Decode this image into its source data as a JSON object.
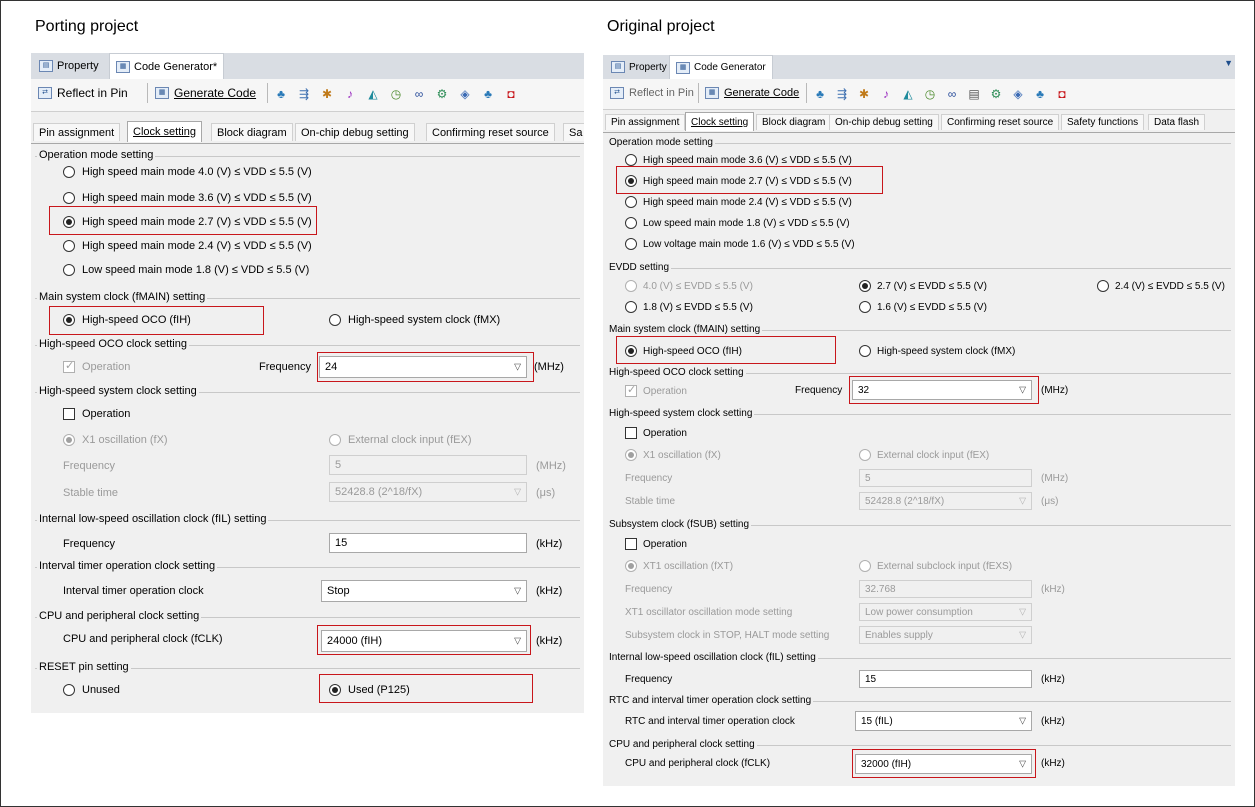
{
  "left": {
    "heading": "Porting project",
    "view_tabs": [
      "Property",
      "Code Generator*"
    ],
    "toolbar": {
      "reflect": "Reflect in Pin",
      "generate": "Generate Code"
    },
    "tabs": [
      "Pin assignment",
      "Clock setting",
      "Block diagram",
      "On-chip debug setting",
      "Confirming reset source",
      "Sa"
    ],
    "op_mode": {
      "title": "Operation mode setting",
      "options": [
        "High speed main mode 4.0 (V) ≤ VDD ≤ 5.5 (V)",
        "High speed main mode 3.6 (V) ≤ VDD ≤ 5.5 (V)",
        "High speed main mode 2.7 (V) ≤ VDD ≤ 5.5 (V)",
        "High speed main mode 2.4 (V) ≤ VDD ≤ 5.5 (V)",
        "Low speed main mode 1.8 (V) ≤ VDD ≤ 5.5 (V)"
      ],
      "selected": 2
    },
    "main_clock": {
      "title": "Main system clock (fMAIN) setting",
      "oco": "High-speed OCO (fIH)",
      "sys": "High-speed system clock (fMX)"
    },
    "oco": {
      "title": "High-speed OCO clock setting",
      "operation": "Operation",
      "freq_label": "Frequency",
      "freq": "24",
      "unit": "(MHz)"
    },
    "hs_sys": {
      "title": "High-speed system clock setting",
      "operation": "Operation",
      "x1": "X1 oscillation (fX)",
      "ext": "External clock input (fEX)",
      "freq_label": "Frequency",
      "freq": "5",
      "freq_unit": "(MHz)",
      "stable_label": "Stable time",
      "stable": "52428.8 (2^18/fX)",
      "stable_unit": "(μs)"
    },
    "fil": {
      "title": "Internal low-speed oscillation clock (fIL) setting",
      "freq_label": "Frequency",
      "freq": "15",
      "unit": "(kHz)"
    },
    "interval": {
      "title": "Interval timer operation clock setting",
      "label": "Interval timer operation clock",
      "value": "Stop",
      "unit": "(kHz)"
    },
    "cpu": {
      "title": "CPU and peripheral clock setting",
      "label": "CPU and peripheral clock (fCLK)",
      "value": "24000 (fIH)",
      "unit": "(kHz)"
    },
    "reset": {
      "title": "RESET pin setting",
      "unused": "Unused",
      "used": "Used (P125)"
    }
  },
  "right": {
    "heading": "Original project",
    "view_tabs": [
      "Property",
      "Code Generator"
    ],
    "toolbar": {
      "reflect": "Reflect in Pin",
      "generate": "Generate Code"
    },
    "tabs": [
      "Pin assignment",
      "Clock setting",
      "Block diagram",
      "On-chip debug setting",
      "Confirming reset source",
      "Safety functions",
      "Data flash"
    ],
    "op_mode": {
      "title": "Operation mode setting",
      "options": [
        "High speed main mode 3.6 (V) ≤ VDD ≤ 5.5 (V)",
        "High speed main mode 2.7 (V) ≤ VDD ≤ 5.5 (V)",
        "High speed main mode 2.4 (V) ≤ VDD ≤ 5.5 (V)",
        "Low speed main mode 1.8 (V) ≤ VDD ≤ 5.5 (V)",
        "Low voltage main mode 1.6 (V) ≤ VDD ≤ 5.5 (V)"
      ],
      "selected": 1
    },
    "evdd": {
      "title": "EVDD setting",
      "o1": "4.0 (V) ≤ EVDD ≤ 5.5 (V)",
      "o2": "2.7 (V) ≤ EVDD ≤ 5.5 (V)",
      "o3": "2.4 (V) ≤ EVDD ≤ 5.5 (V)",
      "o4": "1.8 (V) ≤ EVDD ≤ 5.5 (V)",
      "o5": "1.6 (V) ≤ EVDD ≤ 5.5 (V)"
    },
    "main_clock": {
      "title": "Main system clock (fMAIN) setting",
      "oco": "High-speed OCO (fIH)",
      "sys": "High-speed system clock (fMX)"
    },
    "oco": {
      "title": "High-speed OCO clock setting",
      "operation": "Operation",
      "freq_label": "Frequency",
      "freq": "32",
      "unit": "(MHz)"
    },
    "hs_sys": {
      "title": "High-speed system clock setting",
      "operation": "Operation",
      "x1": "X1 oscillation (fX)",
      "ext": "External clock input (fEX)",
      "freq_label": "Frequency",
      "freq": "5",
      "freq_unit": "(MHz)",
      "stable_label": "Stable time",
      "stable": "52428.8 (2^18/fX)",
      "stable_unit": "(μs)"
    },
    "sub": {
      "title": "Subsystem clock (fSUB) setting",
      "operation": "Operation",
      "xt1": "XT1 oscillation (fXT)",
      "ext": "External subclock input (fEXS)",
      "freq_label": "Frequency",
      "freq": "32.768",
      "freq_unit": "(kHz)",
      "mode_label": "XT1 oscillator oscillation mode setting",
      "mode": "Low power consumption",
      "stop_label": "Subsystem clock in STOP, HALT mode setting",
      "stop": "Enables supply"
    },
    "fil": {
      "title": "Internal low-speed oscillation clock (fIL) setting",
      "freq_label": "Frequency",
      "freq": "15",
      "unit": "(kHz)"
    },
    "rtc": {
      "title": "RTC and interval timer operation clock setting",
      "label": "RTC and interval timer operation clock",
      "value": "15 (fIL)",
      "unit": "(kHz)"
    },
    "cpu": {
      "title": "CPU and peripheral clock setting",
      "label": "CPU and peripheral clock (fCLK)",
      "value": "32000 (fIH)",
      "unit": "(kHz)"
    }
  }
}
